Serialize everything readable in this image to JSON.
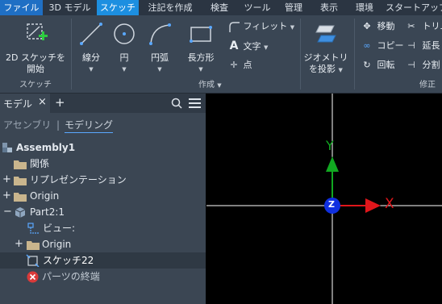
{
  "menu": {
    "tabs": [
      "ファイル",
      "3D モデル",
      "スケッチ",
      "注記を作成",
      "検査",
      "ツール",
      "管理",
      "表示",
      "環境",
      "スタートアップ"
    ]
  },
  "ribbon": {
    "sketch_panel": {
      "start_2d": "2D スケッチを",
      "start_2d_2": "開始",
      "label": "スケッチ"
    },
    "create_panel": {
      "line": "線分",
      "circle": "円",
      "arc": "円弧",
      "rectangle": "長方形",
      "fillet": "フィレット",
      "text": "文字",
      "point": "点",
      "label": "作成"
    },
    "geometry": {
      "line1": "ジオメトリ",
      "line2": "を投影"
    },
    "modify_panel": {
      "move": "移動",
      "trim": "トリム",
      "copy": "コピー",
      "extend": "延長",
      "rotate": "回転",
      "split": "分割",
      "label": "修正"
    }
  },
  "browser": {
    "tab_label": "モデル",
    "close_glyph": "×",
    "add_glyph": "+",
    "assembly_label": "アセンブリ",
    "divider": "|",
    "modeling_label": "モデリング",
    "tree": [
      {
        "label": "Assembly1"
      },
      {
        "label": "関係"
      },
      {
        "label": "リプレゼンテーション"
      },
      {
        "label": "Origin"
      },
      {
        "label": "Part2:1"
      },
      {
        "label": "ビュー:"
      },
      {
        "label": "Origin"
      },
      {
        "label": "スケッチ22"
      },
      {
        "label": "パーツの終端"
      }
    ]
  },
  "viewport": {
    "axis_y_label": "Y",
    "axis_x_label": "X",
    "axis_z_label": "Z"
  },
  "colors": {
    "accent": "#1d8fe0",
    "x_axis": "#e0161b",
    "y_axis": "#11a821",
    "z_axis": "#1030e0"
  }
}
